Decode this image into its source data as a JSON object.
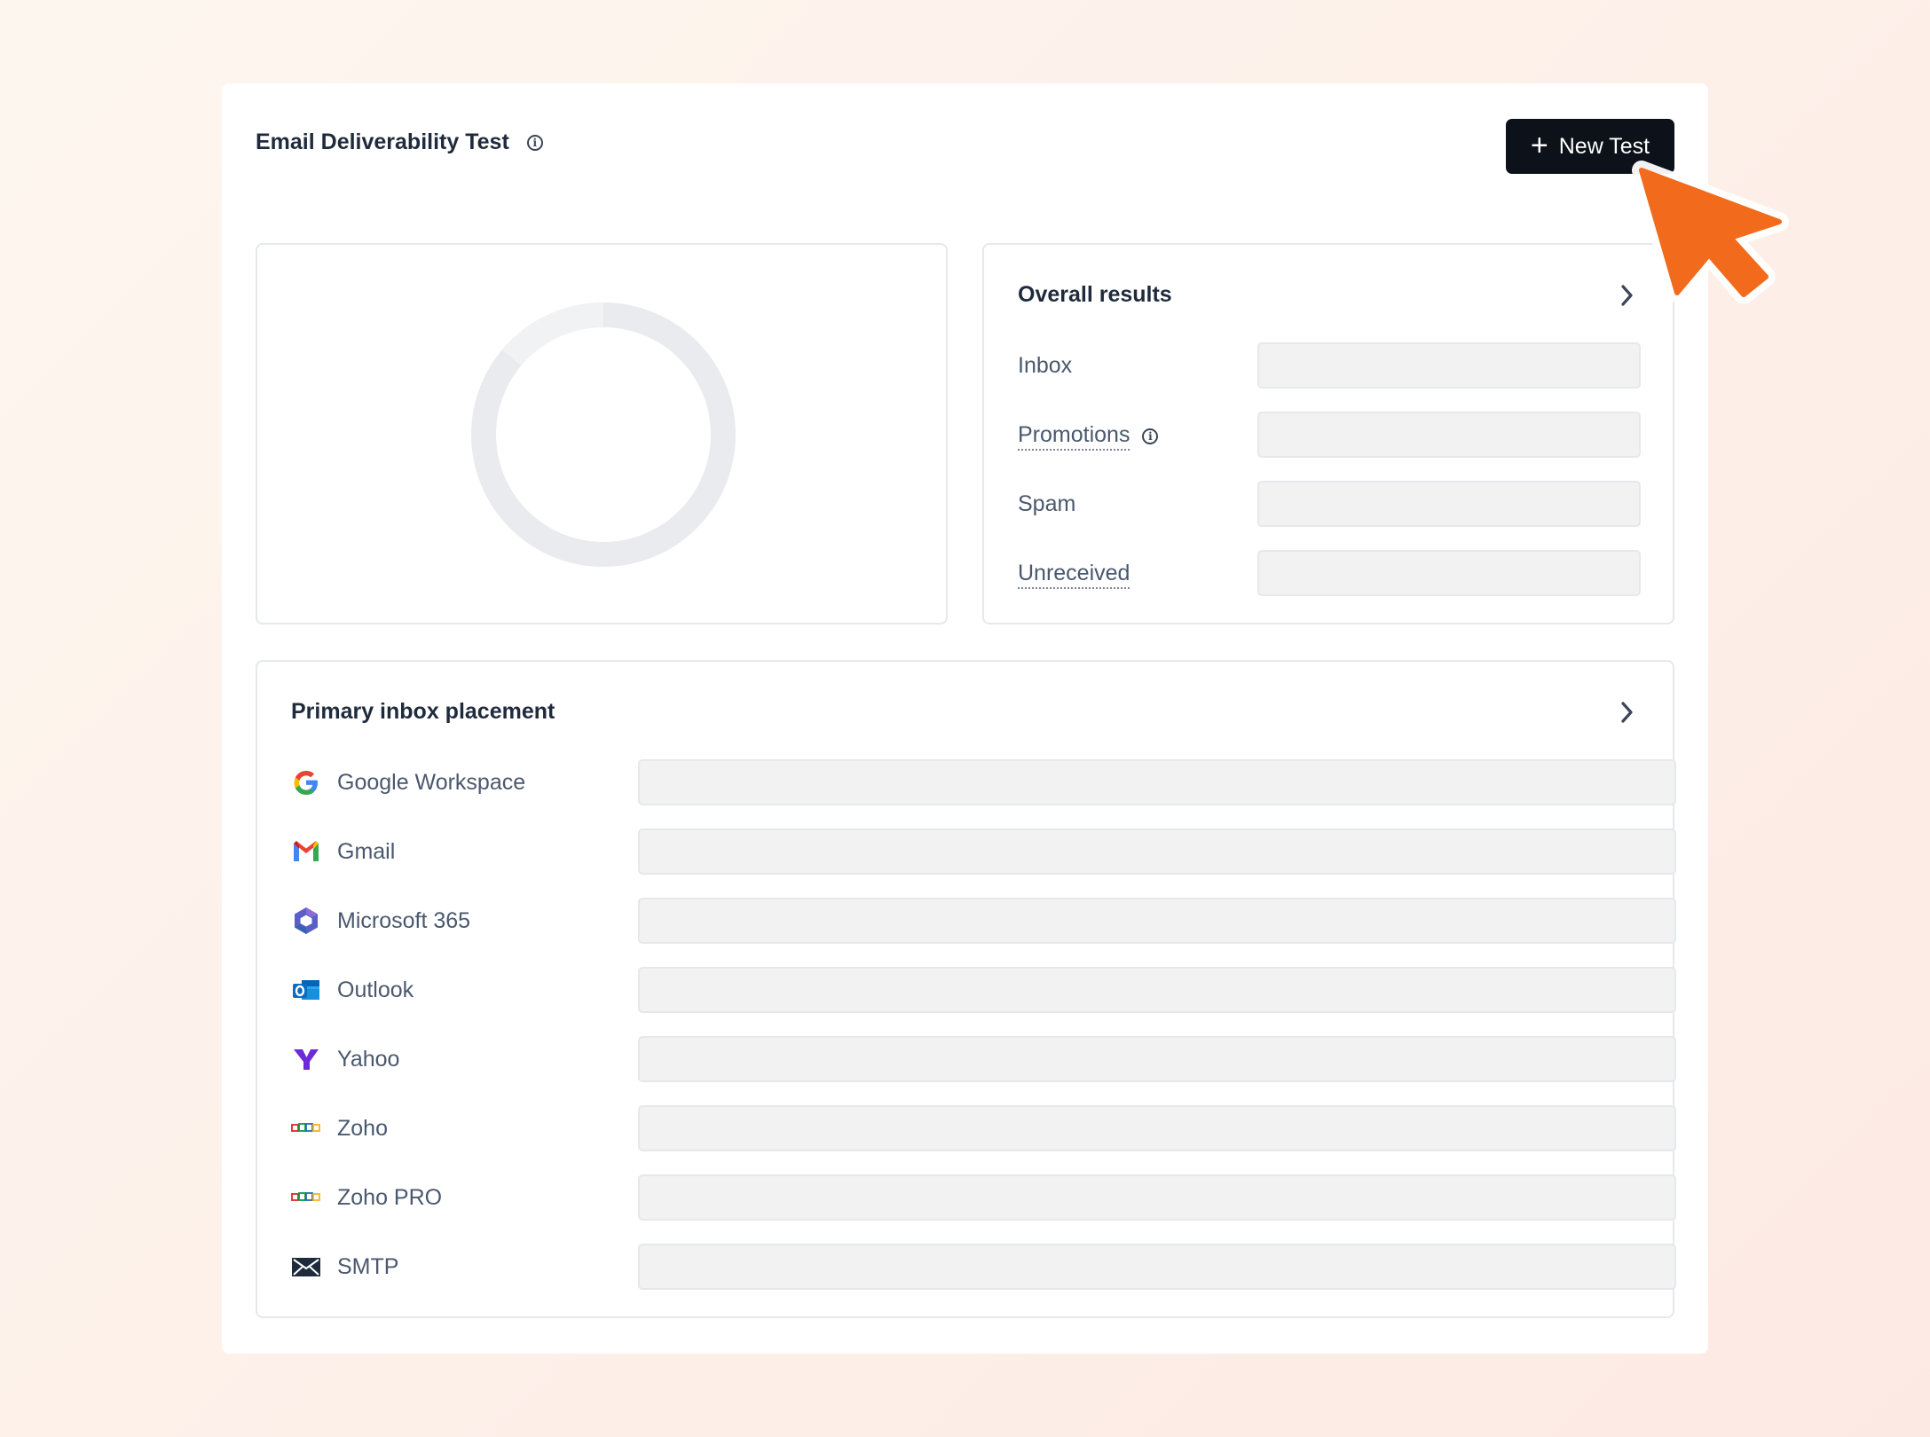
{
  "header": {
    "title": "Email Deliverability Test",
    "new_test_label": "New Test"
  },
  "overall": {
    "title": "Overall results",
    "rows": [
      {
        "label": "Inbox"
      },
      {
        "label": "Promotions"
      },
      {
        "label": "Spam"
      },
      {
        "label": "Unreceived"
      }
    ]
  },
  "primary": {
    "title": "Primary inbox placement",
    "providers": [
      {
        "label": "Google Workspace",
        "icon": "google-icon"
      },
      {
        "label": "Gmail",
        "icon": "gmail-icon"
      },
      {
        "label": "Microsoft 365",
        "icon": "microsoft-365-icon"
      },
      {
        "label": "Outlook",
        "icon": "outlook-icon"
      },
      {
        "label": "Yahoo",
        "icon": "yahoo-icon"
      },
      {
        "label": "Zoho",
        "icon": "zoho-icon"
      },
      {
        "label": "Zoho PRO",
        "icon": "zoho-icon"
      },
      {
        "label": "SMTP",
        "icon": "envelope-icon"
      }
    ]
  },
  "colors": {
    "button_bg": "#0c111a",
    "placeholder_bar": "#f2f2f2",
    "donut_track": "#e9ebee",
    "cursor_accent": "#f26a1b"
  }
}
